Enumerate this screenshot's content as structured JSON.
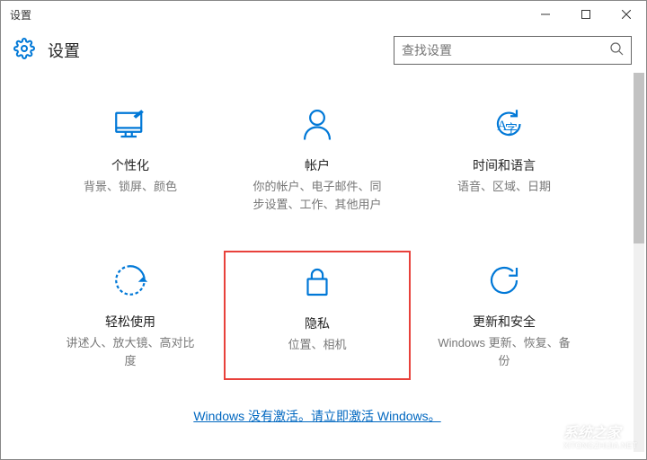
{
  "window": {
    "title": "设置"
  },
  "header": {
    "title": "设置"
  },
  "search": {
    "placeholder": "查找设置"
  },
  "tiles": {
    "personalization": {
      "title": "个性化",
      "desc": "背景、锁屏、颜色"
    },
    "accounts": {
      "title": "帐户",
      "desc": "你的帐户、电子邮件、同步设置、工作、其他用户"
    },
    "timelang": {
      "title": "时间和语言",
      "desc": "语音、区域、日期"
    },
    "ease": {
      "title": "轻松使用",
      "desc": "讲述人、放大镜、高对比度"
    },
    "privacy": {
      "title": "隐私",
      "desc": "位置、相机"
    },
    "update": {
      "title": "更新和安全",
      "desc": "Windows 更新、恢复、备份"
    }
  },
  "activation": {
    "text": "Windows 没有激活。请立即激活 Windows。"
  },
  "watermark": {
    "name": "系统之家",
    "url": "XITONGZHIJIA.NET"
  }
}
